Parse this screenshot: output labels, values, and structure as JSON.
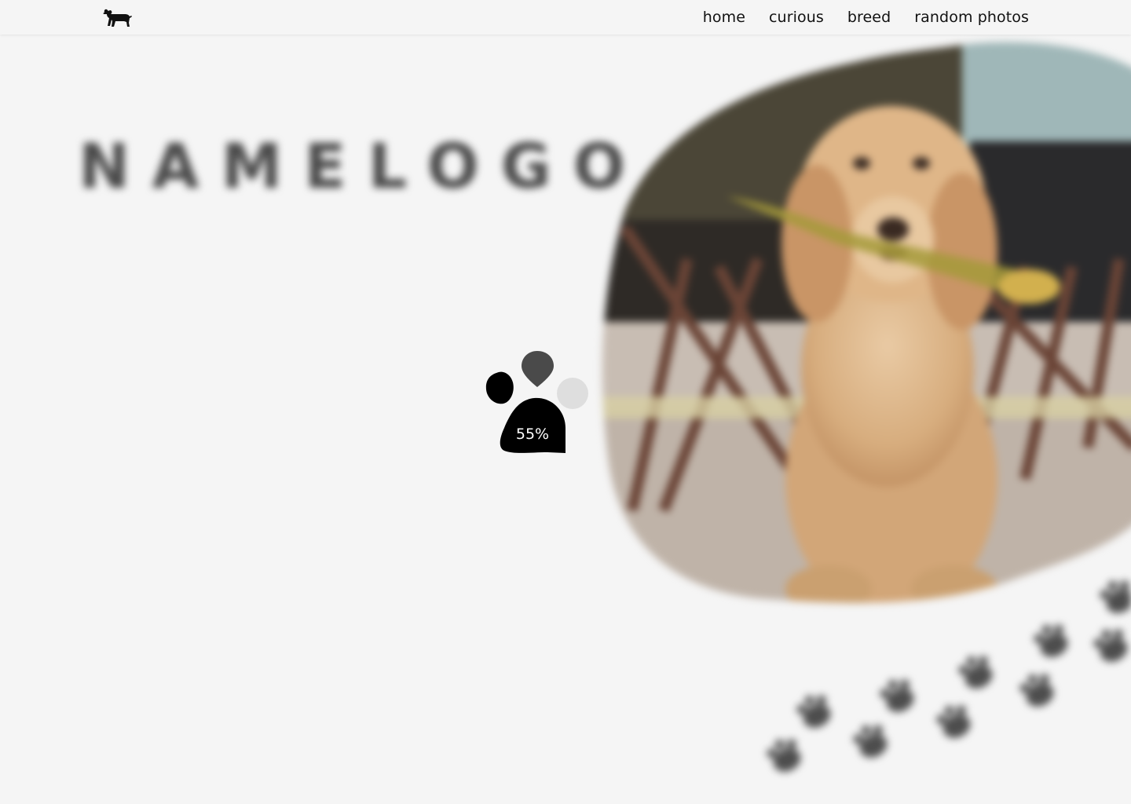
{
  "nav": {
    "logo_icon": "dog-icon",
    "links": [
      "home",
      "curious",
      "breed",
      "random photos"
    ]
  },
  "hero": {
    "brand_logo": "NAMELOGO",
    "image": "dog-photo",
    "decoration": "paw-prints-trail-icon"
  },
  "loader": {
    "icon": "paw-icon",
    "progress_text": "55%",
    "progress": 0.55
  },
  "colors": {
    "background": "#f5f5f5",
    "text": "#111111",
    "loader": "#000000"
  }
}
